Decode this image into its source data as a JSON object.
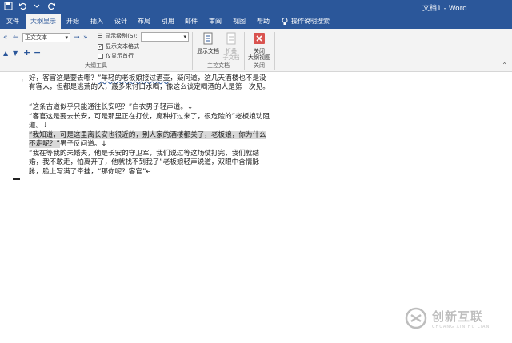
{
  "window": {
    "document_title": "文档1 - Word"
  },
  "qat": {
    "save_icon": "save-icon",
    "undo_icon": "undo-icon",
    "redo_icon": "redo-icon"
  },
  "tabs": [
    {
      "label": "文件"
    },
    {
      "label": "大纲显示"
    },
    {
      "label": "开始"
    },
    {
      "label": "插入"
    },
    {
      "label": "设计"
    },
    {
      "label": "布局"
    },
    {
      "label": "引用"
    },
    {
      "label": "邮件"
    },
    {
      "label": "审阅"
    },
    {
      "label": "视图"
    },
    {
      "label": "帮助"
    },
    {
      "label": "操作说明搜索"
    }
  ],
  "ribbon": {
    "outline_level_value": "正文文本",
    "show_level_label": "显示级别(S):",
    "show_text_format_label": "显示文本格式",
    "show_first_line_label": "仅显示首行",
    "outline_tools_label": "大纲工具",
    "show_document_label": "显示文档",
    "collapse_subdoc_label": "折叠\n子文档",
    "master_doc_label": "主控文档",
    "close_outline_label": "关闭\n大纲视图",
    "close_group_label": "关闭"
  },
  "document": {
    "p1_a": "好，客官这是要去哪？",
    "p1_b": "”年轻的老板娘接过酒壶",
    "p1_c": "，疑问道，这几天酒楼也不是没有客人，但都是逃荒的人，最多来讨口水喝，像这么谈定喝酒的人是第一次见。",
    "p2": "“这条古道似乎只能通往长安吧？”白衣男子轻声道。↓",
    "p3": "“客官这是要去长安，可是那里正在打仗，魔种打过来了，很危险的”老板娘劝阻道。↓",
    "p4_hl": "“我知道，可是这里离长安也很近的，别人家的酒楼都关了，老板娘，你为什么不走呢？”",
    "p4_tail": "男子反问道。↓",
    "p5": "“我在等我的未婚夫，他是长安的守卫军，我们说过等这场仗打完，我们就结婚，我不敢走，怕离开了，他就找不到我了”老板娘轻声说道，双眼中含情脉脉，脸上写满了牵挂，“那你呢？客官”↵"
  },
  "watermark": {
    "brand": "创新互联",
    "sub": "CHUANG XIN HU LIAN"
  }
}
